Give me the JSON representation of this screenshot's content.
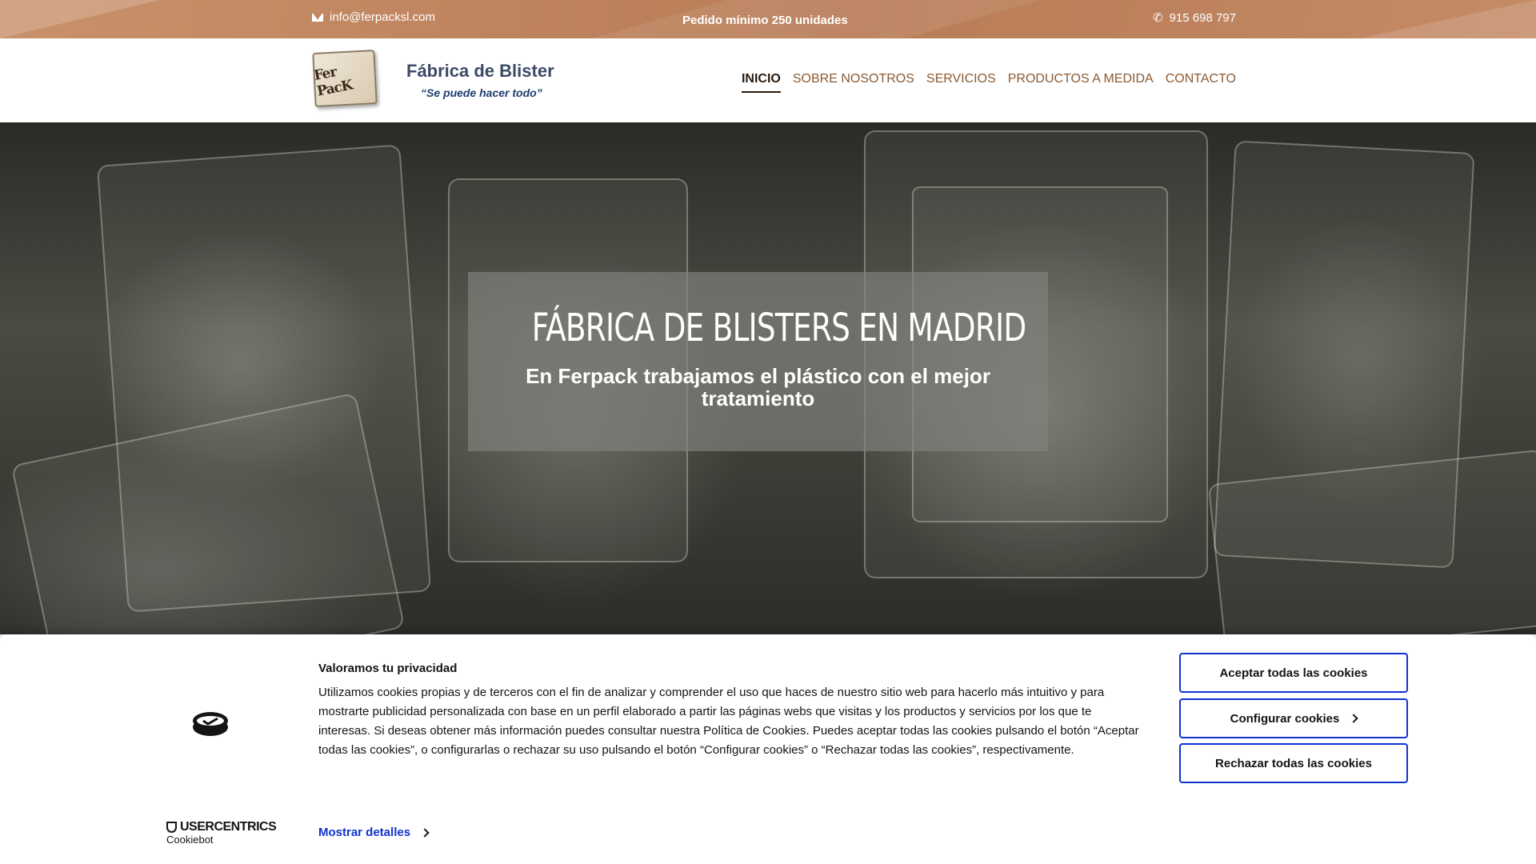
{
  "topbar": {
    "email": "info@ferpacksl.com",
    "min_order": "Pedido mínimo 250 unidades",
    "phone": "915 698 797"
  },
  "header": {
    "logo_text": "Fer PacK",
    "brand_title": "Fábrica de Blister",
    "brand_slogan": "“Se puede hacer todo”",
    "nav": [
      {
        "label": "INICIO",
        "active": true
      },
      {
        "label": "SOBRE NOSOTROS",
        "active": false
      },
      {
        "label": "SERVICIOS",
        "active": false
      },
      {
        "label": "PRODUCTOS A MEDIDA",
        "active": false
      },
      {
        "label": "CONTACTO",
        "active": false
      }
    ]
  },
  "hero": {
    "title": "FÁBRICA DE BLISTERS EN MADRID",
    "subtitle": "En Ferpack trabajamos el plástico con el mejor tratamiento"
  },
  "cookie_banner": {
    "title": "Valoramos tu privacidad",
    "text": "Utilizamos cookies propias y de terceros con el fin de analizar y comprender el uso que haces de nuestro sitio web para hacerlo más intuitivo y para mostrarte publicidad personalizada con base en un perfil elaborado a partir las páginas webs que visitas y los productos y servicios por los que te interesas. Si deseas obtener más información puedes consultar nuestra Política de Cookies. Puedes aceptar todas las cookies pulsando el botón “Aceptar todas las cookies”, o configurarlas o rechazar su uso pulsando el botón “Configurar cookies” o “Rechazar todas las cookies”, respectivamente.",
    "accept_label": "Aceptar todas las cookies",
    "configure_label": "Configurar cookies",
    "reject_label": "Rechazar todas las cookies",
    "details_label": "Mostrar detalles",
    "brand_line1": "USERCENTRICS",
    "brand_line2": "Cookiebot"
  },
  "colors": {
    "topbar": "#bf8560",
    "nav_link": "#8a5a33",
    "nav_active": "#2a1a0d",
    "cookie_accent": "#1032cf"
  }
}
